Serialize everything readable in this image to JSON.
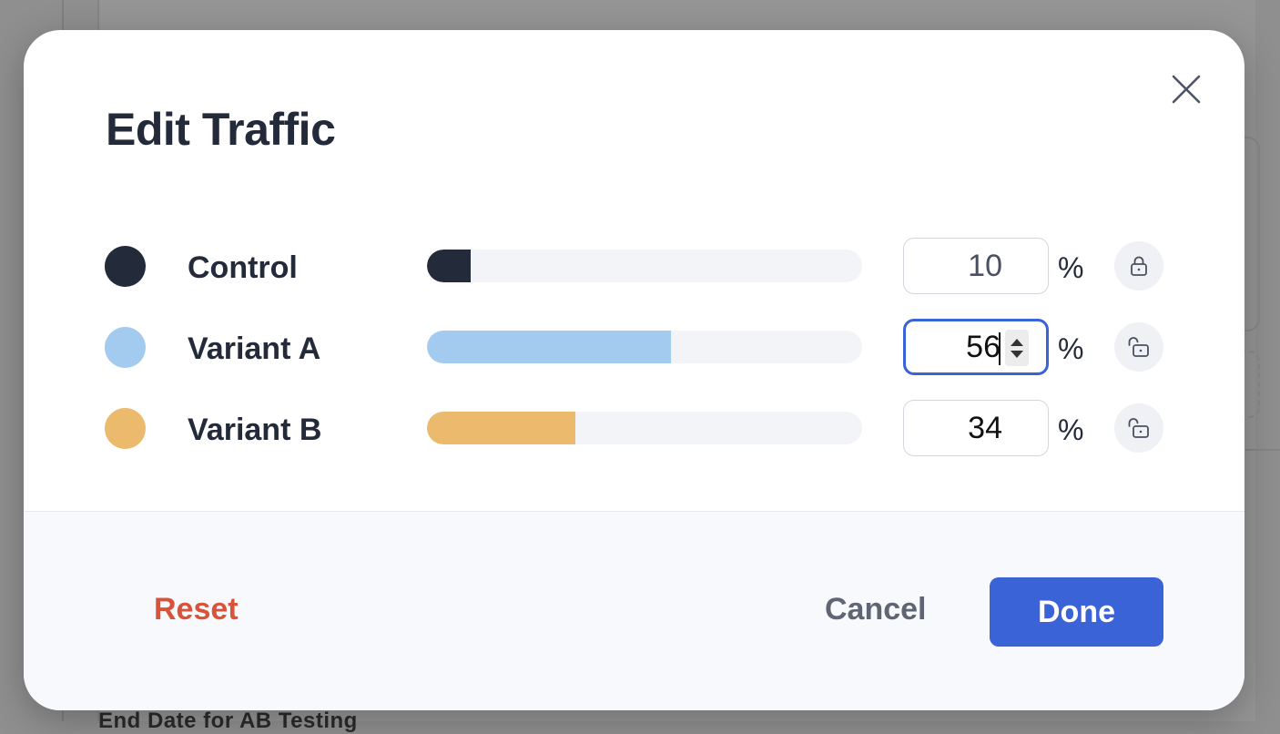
{
  "background": {
    "partial_text": "End Date for AB Testing"
  },
  "modal": {
    "title": "Edit Traffic",
    "close_icon": "close-icon",
    "unit": "%",
    "variants": [
      {
        "name": "Control",
        "value": "10",
        "color": "#232a3a",
        "locked": true,
        "focused": false
      },
      {
        "name": "Variant A",
        "value": "56",
        "color": "#a2cbef",
        "locked": false,
        "focused": true
      },
      {
        "name": "Variant B",
        "value": "34",
        "color": "#ecba6c",
        "locked": false,
        "focused": false
      }
    ],
    "footer": {
      "reset_label": "Reset",
      "cancel_label": "Cancel",
      "done_label": "Done"
    }
  },
  "colors": {
    "accent": "#3b63d8",
    "danger": "#d9533b",
    "track": "#f3f4f8"
  }
}
